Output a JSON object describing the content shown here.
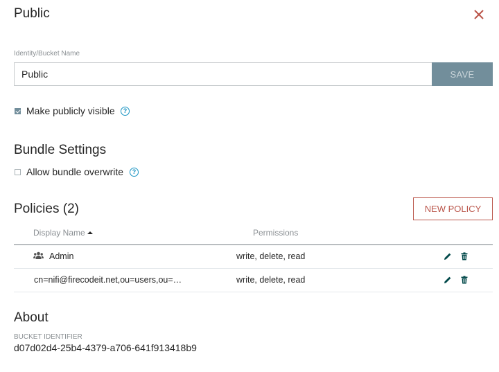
{
  "dialog": {
    "title": "Public"
  },
  "identity": {
    "label": "Identity/Bucket Name",
    "value": "Public",
    "save_label": "SAVE"
  },
  "visibility": {
    "label": "Make publicly visible",
    "checked": true
  },
  "bundle": {
    "title": "Bundle Settings",
    "allow_overwrite_label": "Allow bundle overwrite",
    "checked": false
  },
  "policies": {
    "title": "Policies (2)",
    "new_policy_label": "NEW POLICY",
    "columns": {
      "display_name": "Display Name",
      "permissions": "Permissions"
    },
    "rows": [
      {
        "name": "Admin",
        "icon": "users-icon",
        "permissions": "write, delete, read"
      },
      {
        "name": "cn=nifi@firecodeit.net,ou=users,ou=…",
        "icon": "",
        "permissions": "write, delete, read"
      }
    ]
  },
  "about": {
    "title": "About",
    "id_label": "BUCKET IDENTIFIER",
    "id_value": "d07d02d4-25b4-4379-a706-641f913418b9"
  },
  "colors": {
    "accent": "#ba554a",
    "save_button": "#728e9b",
    "help": "#1491c1"
  }
}
